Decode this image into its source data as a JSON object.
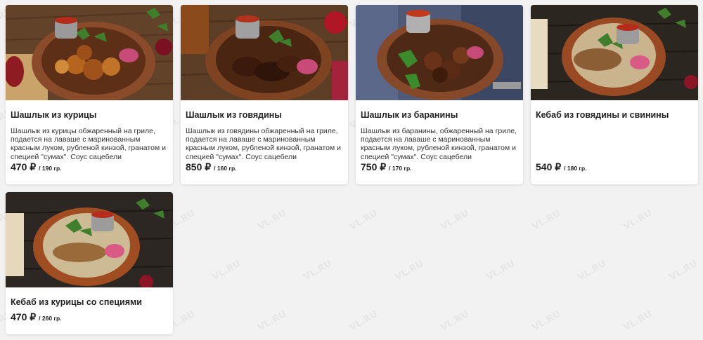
{
  "watermark": {
    "text": "VL.RU"
  },
  "menu": {
    "items": [
      {
        "title": "Шашлык из курицы",
        "description": "Шашлык из курицы обжаренный на гриле, подается на лаваше с маринованным красным луком,  рубленой кинзой, гранатом и специей \"сумах\". Соус сацебели",
        "price": "470 ₽",
        "weight": "/ 190 гр.",
        "image": "chicken-shashlik-photo"
      },
      {
        "title": "Шашлык из говядины",
        "description": "Шашлык из говядины обжаренный на гриле, подается на лаваше с маринованным красным луком,  рубленой кинзой, гранатом и специей \"сумах\". Соус сацебели",
        "price": "850 ₽",
        "weight": "/ 160 гр.",
        "image": "beef-shashlik-photo"
      },
      {
        "title": "Шашлык из баранины",
        "description": "Шашлык из баранины, обжаренный на гриле, подается на лаваше с маринованным красным луком,  рубленой кинзой, гранатом и специей \"сумах\". Соус сацебели",
        "price": "750 ₽",
        "weight": "/ 170 гр.",
        "image": "lamb-shashlik-photo"
      },
      {
        "title": "Кебаб из говядины и свинины",
        "description": "",
        "price": "540 ₽",
        "weight": "/ 180 гр.",
        "image": "beef-pork-kebab-photo"
      },
      {
        "title": "Кебаб из курицы со специями",
        "description": "",
        "price": "470 ₽",
        "weight": "/ 260 гр.",
        "image": "spiced-chicken-kebab-photo"
      }
    ]
  }
}
